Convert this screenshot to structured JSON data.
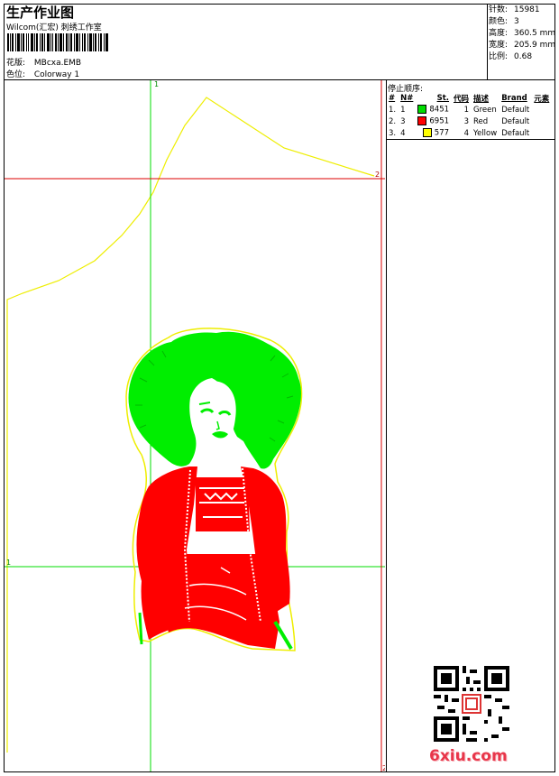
{
  "header": {
    "title": "生产作业图",
    "subtitle": "Wilcom(汇宏) 刺绣工作室",
    "design_label": "花版:",
    "design_value": "MBcxa.EMB",
    "colorway_label": "色位:",
    "colorway_value": "Colorway 1"
  },
  "stats": [
    {
      "label": "针数:",
      "value": "15981"
    },
    {
      "label": "颜色:",
      "value": "3"
    },
    {
      "label": "高度:",
      "value": "360.5 mm"
    },
    {
      "label": "宽度:",
      "value": "205.9 mm"
    },
    {
      "label": "比例:",
      "value": "0.68"
    }
  ],
  "stop_sequence": {
    "title": "停止顺序:",
    "columns": [
      "#",
      "N#",
      "St.",
      "代码",
      "描述",
      "Brand",
      "元素"
    ],
    "rows": [
      {
        "num": "1.",
        "n": "1",
        "color": "#00dd00",
        "stitches": "8451",
        "code": "1",
        "desc": "Green",
        "brand": "Default"
      },
      {
        "num": "2.",
        "n": "3",
        "color": "#ff0000",
        "stitches": "6951",
        "code": "3",
        "desc": "Red",
        "brand": "Default"
      },
      {
        "num": "3.",
        "n": "4",
        "color": "#ffff00",
        "stitches": "577",
        "code": "4",
        "desc": "Yellow",
        "brand": "Default"
      }
    ]
  },
  "canvas": {
    "guide_label_top": "1",
    "guide_label_left": "1",
    "guide_label_right": "2",
    "guide_label_corner": "2",
    "colors": {
      "green": "#00ee00",
      "red": "#ff0000",
      "yellow": "#eeee00"
    }
  },
  "watermark": {
    "site": "6xiu.com"
  }
}
